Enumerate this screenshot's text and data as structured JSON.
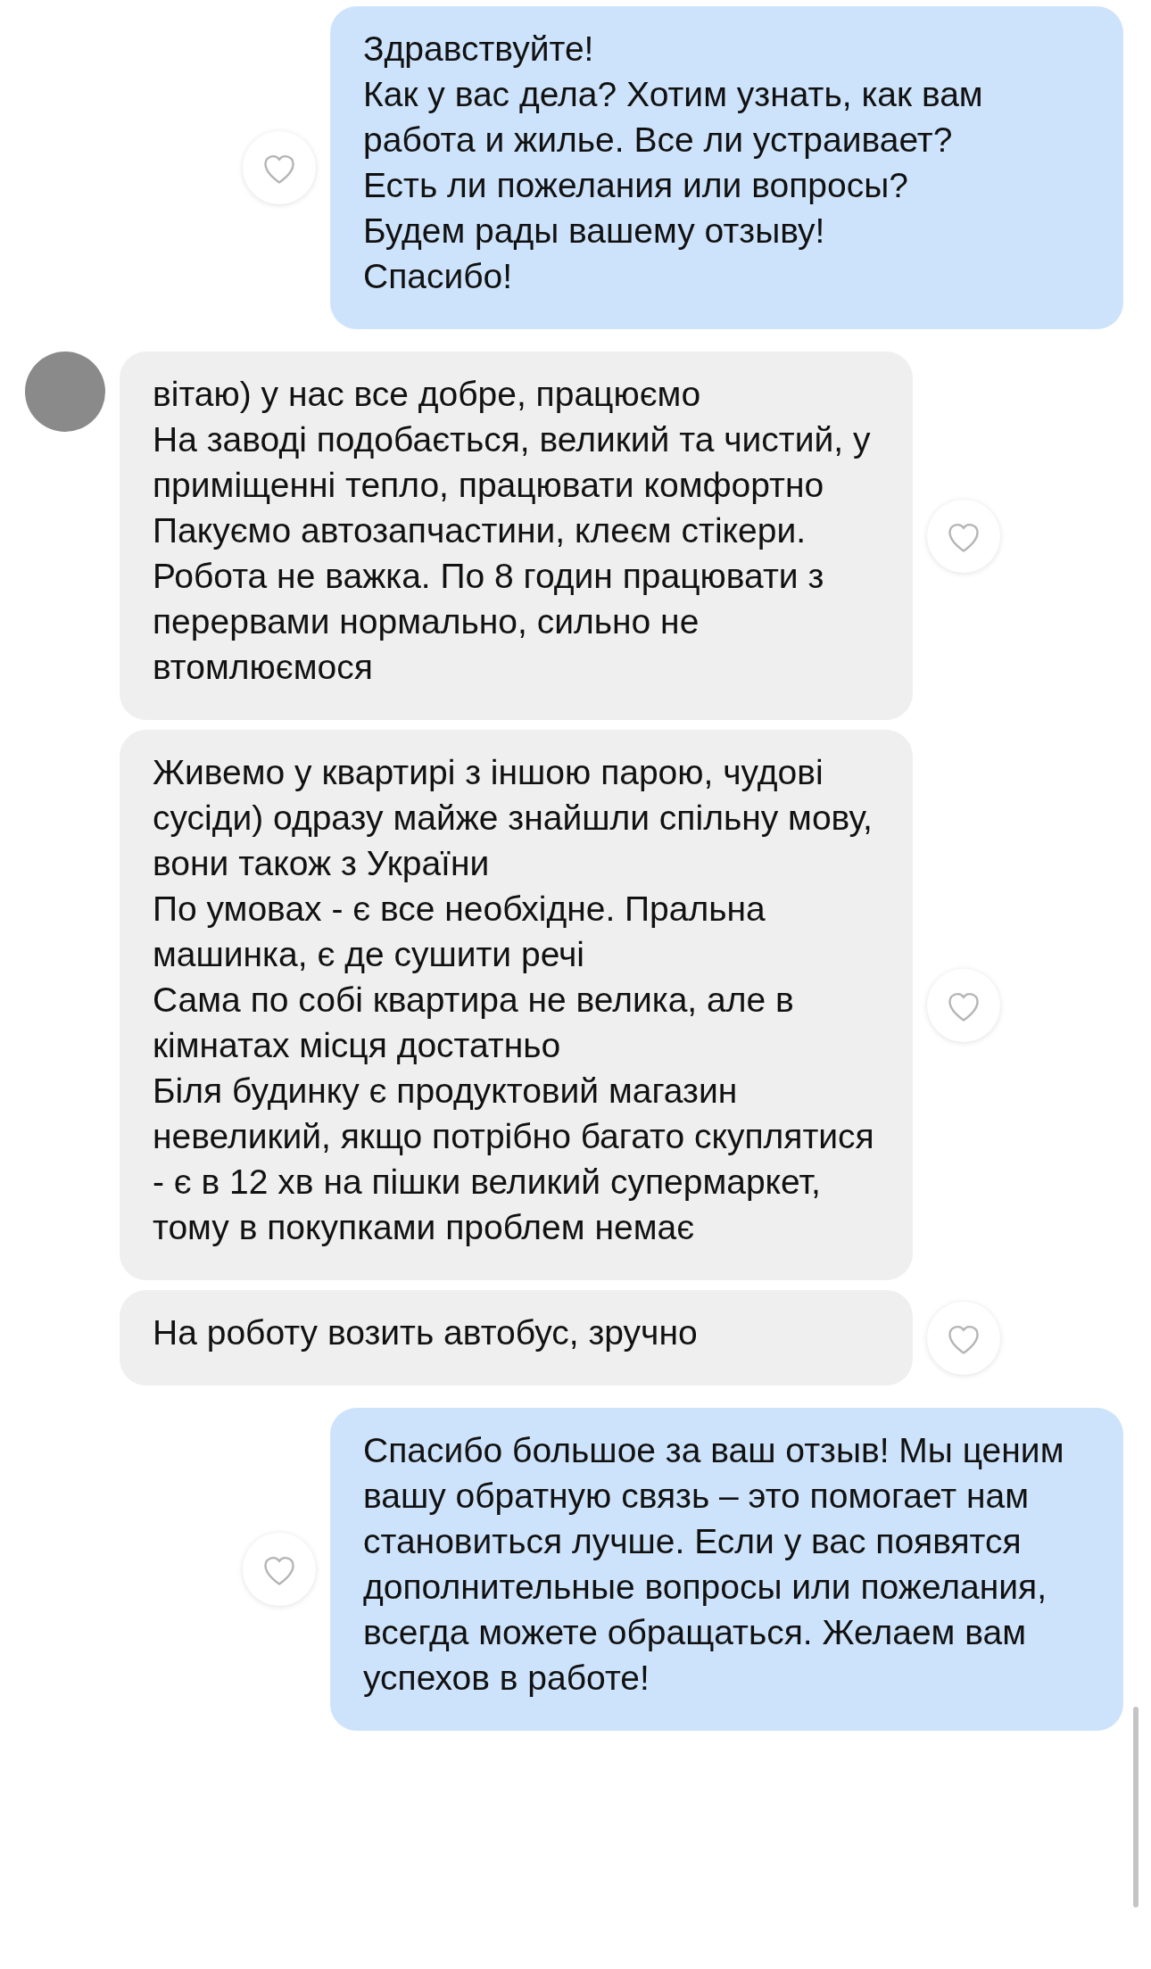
{
  "messages": [
    {
      "kind": "outgoing",
      "paragraphs": [
        "Здравствуйте!",
        "Как у вас дела? Хотим узнать, как вам работа и жилье. Все ли устраивает?",
        "Есть ли пожелания или вопросы?",
        "Будем рады вашему отзыву!",
        "Спасибо!"
      ]
    },
    {
      "kind": "incoming",
      "avatar": true,
      "paragraphs": [
        "вітаю) у нас все добре, працюємо",
        "На заводі подобається, великий та чистий, у приміщенні тепло, працювати комфортно",
        "Пакуємо автозапчастини, клеєм стікери. Робота не важка. По 8 годин працювати з перервами нормально, сильно не втомлюємося"
      ]
    },
    {
      "kind": "incoming",
      "avatar": false,
      "paragraphs": [
        "Живемо у квартирі з іншою парою, чудові сусіди) одразу майже знайшли спільну мову, вони також з України",
        "По умовах - є все необхідне. Пральна машинка, є де сушити речі",
        "Сама по собі квартира не велика, але в кімнатах місця достатньо",
        "Біля будинку є продуктовий магазин невеликий, якщо потрібно багато скуплятися - є в 12 хв на пішки великий супермаркет, тому в покупками проблем немає"
      ]
    },
    {
      "kind": "incoming",
      "avatar": false,
      "paragraphs": [
        "На роботу  возить автобус, зручно"
      ]
    },
    {
      "kind": "outgoing",
      "paragraphs": [
        "Спасибо большое за ваш отзыв! Мы ценим вашу обратную связь – это помогает нам становиться лучше. Если у вас появятся дополнительные вопросы или пожелания, всегда можете обращаться. Желаем вам успехов в работе!"
      ]
    }
  ]
}
